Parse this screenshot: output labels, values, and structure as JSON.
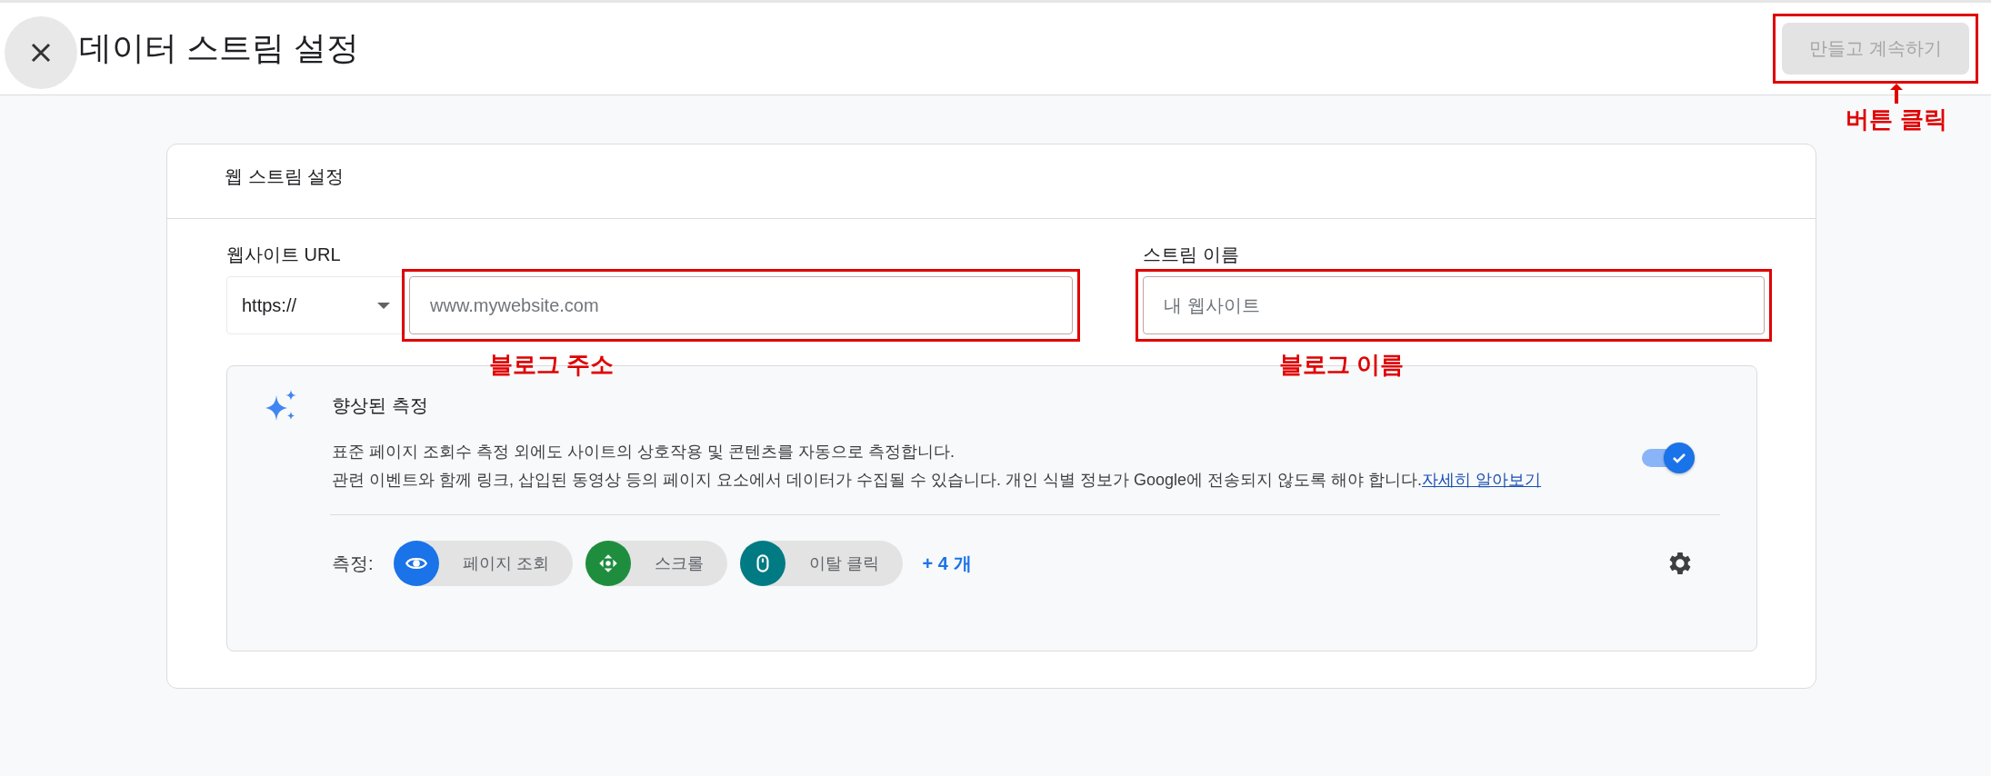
{
  "header": {
    "title": "데이터 스트림 설정",
    "button": {
      "label": "만들고 계속하기",
      "disabled": true,
      "annotation": "버튼 클릭"
    }
  },
  "card": {
    "title": "웹 스트림 설정",
    "fields": [
      {
        "kind": "url",
        "label": "웹사이트 URL",
        "protocol": "https://",
        "placeholder": "www.mywebsite.com",
        "annotation": "블로그 주소"
      },
      {
        "kind": "text",
        "label": "스트림 이름",
        "placeholder": "내 웹사이트",
        "annotation": "블로그 이름"
      }
    ],
    "enhanced_measurement": {
      "title": "향상된 측정",
      "description": [
        "표준 페이지 조회수 측정 외에도 사이트의 상호작용 및 콘텐츠를 자동으로 측정합니다.",
        "관련 이벤트와 함께 링크, 삽입된 동영상 등의 페이지 요소에서 데이터가 수집될 수 있습니다. 개인 식별 정보가 Google에 전송되지 않도록 해야 합니다."
      ],
      "link": "자세히 알아보기",
      "on": true,
      "measures_label": "측정:",
      "chips": [
        {
          "kind": "eye",
          "label": "페이지 조회",
          "color": "#1a73e8"
        },
        {
          "kind": "scroll",
          "label": "스크롤",
          "color": "#1e8e3e"
        },
        {
          "kind": "mouse",
          "label": "이탈 클릭",
          "color": "#007b83"
        }
      ],
      "more": "+ 4 개"
    }
  }
}
